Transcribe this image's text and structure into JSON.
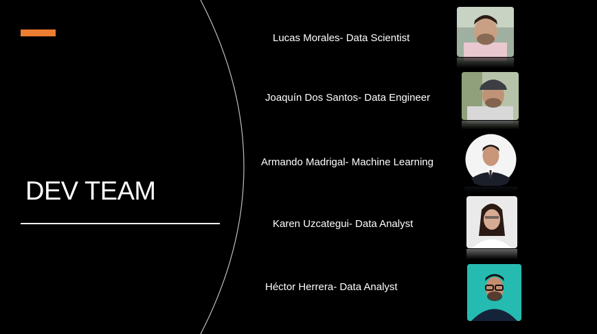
{
  "slide": {
    "title": "DEV TEAM",
    "accent_color": "#ED7D31",
    "rule_color": "#F2F2F2",
    "arc_color": "#BFBFBF"
  },
  "team": [
    {
      "label": "Lucas Morales- Data Scientist",
      "avatar": "person-photo"
    },
    {
      "label": "Joaquín Dos Santos- Data Engineer",
      "avatar": "person-photo"
    },
    {
      "label": "Armando Madrigal- Machine Learning",
      "avatar": "person-photo"
    },
    {
      "label": "Karen Uzcategui- Data Analyst",
      "avatar": "person-photo"
    },
    {
      "label": "Héctor Herrera- Data Analyst",
      "avatar": "person-photo"
    }
  ]
}
